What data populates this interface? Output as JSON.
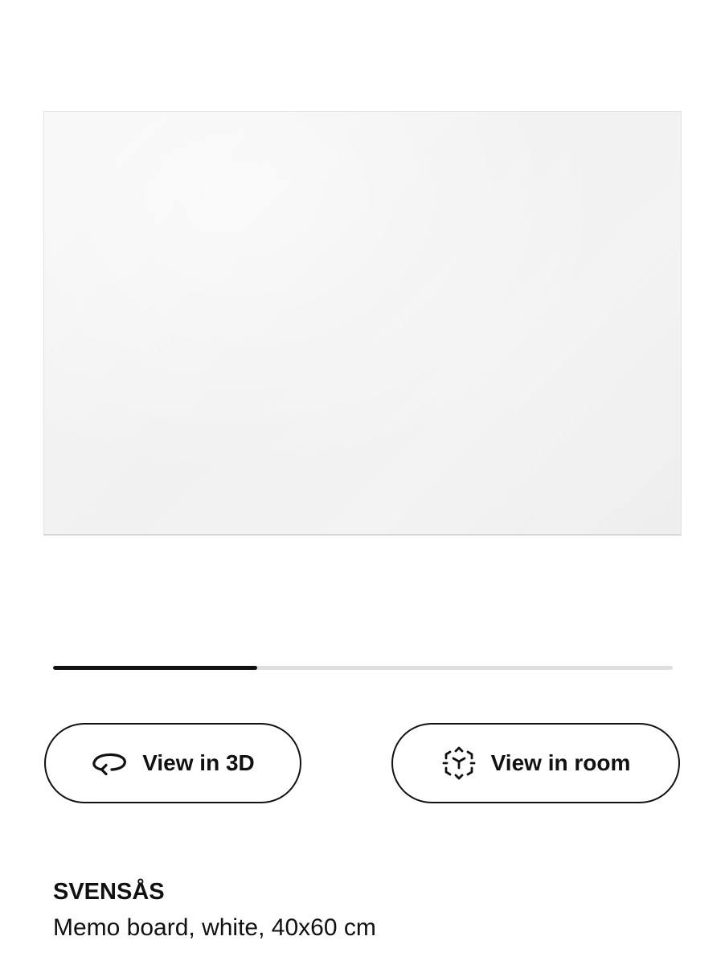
{
  "gallery": {
    "image_progress": 0.33
  },
  "actions": {
    "view_3d": {
      "label": "View in 3D",
      "icon": "rotate-3d-icon"
    },
    "view_room": {
      "label": "View in room",
      "icon": "ar-cube-icon"
    }
  },
  "product": {
    "name": "SVENSÅS",
    "description": "Memo board, white, 40x60 cm"
  },
  "colors": {
    "text": "#111111",
    "progress_track": "#dfdfdf",
    "progress_fill": "#111111",
    "background": "#ffffff"
  }
}
